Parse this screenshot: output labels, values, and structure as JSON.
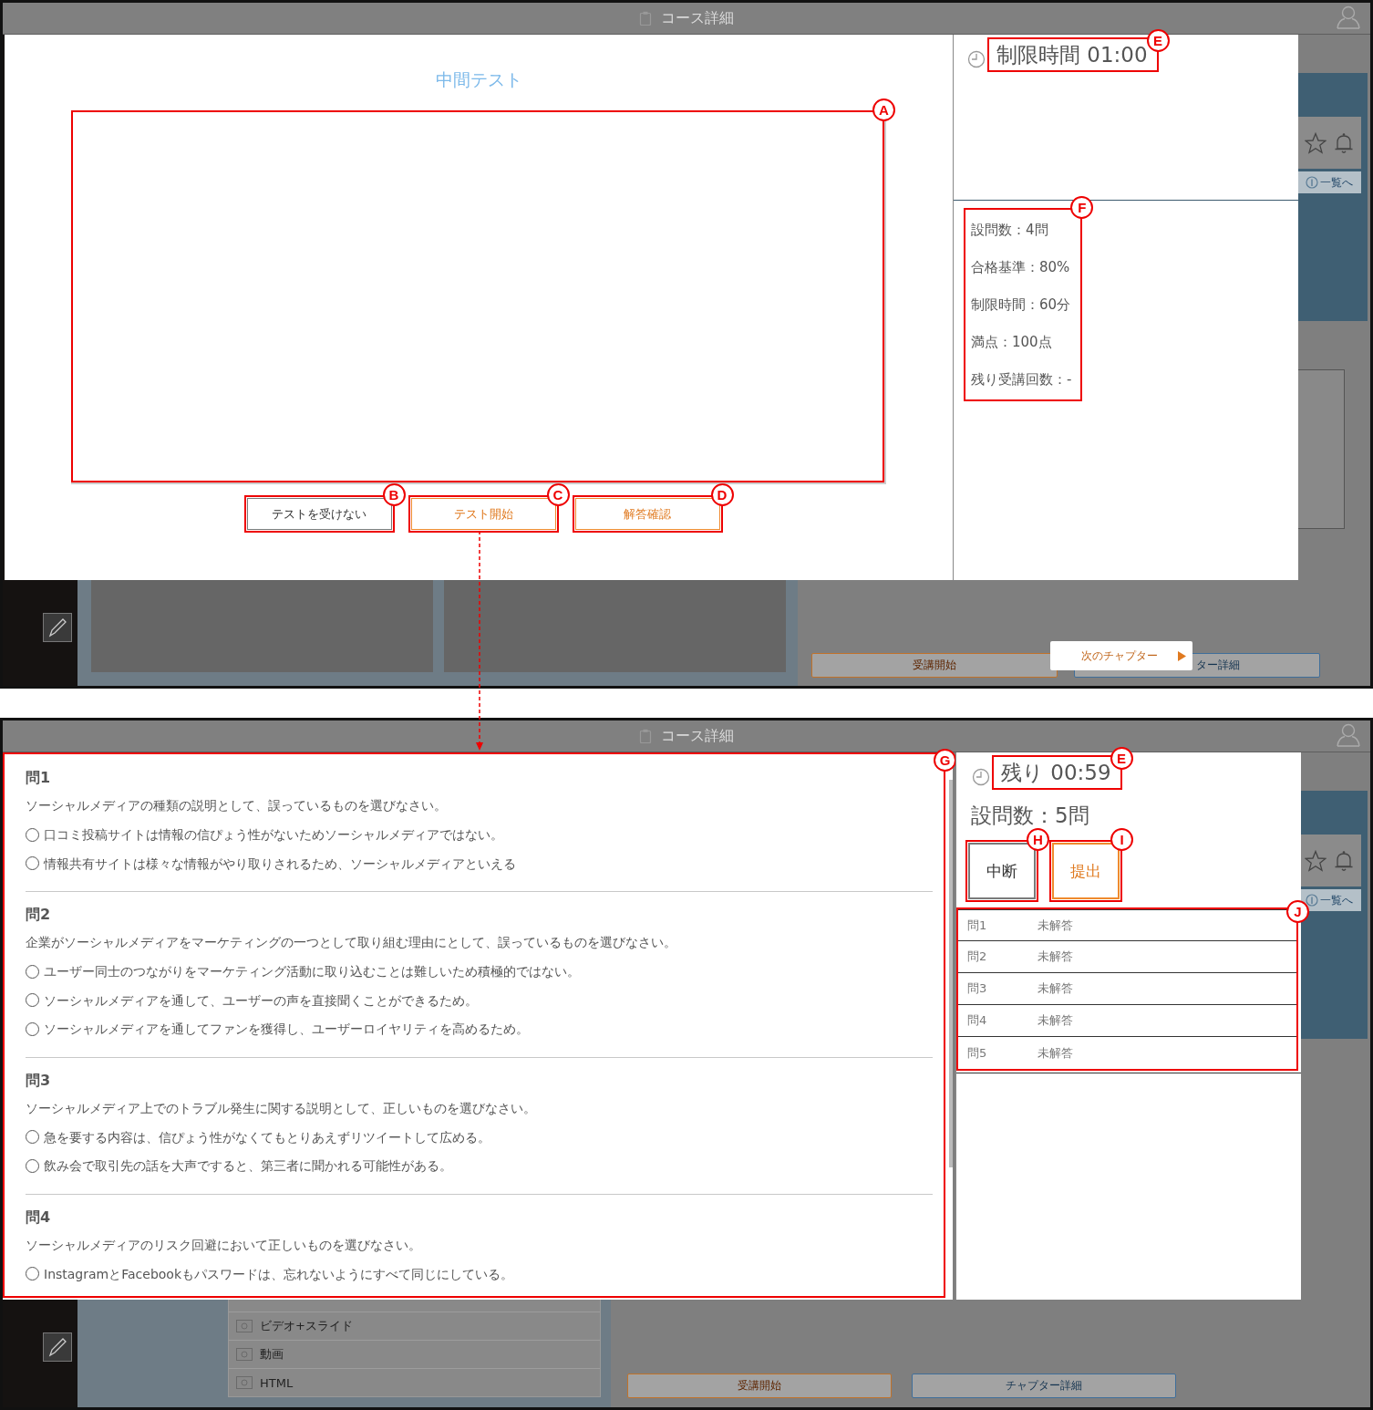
{
  "screen_1": {
    "window_title": "コース詳細",
    "background": {
      "list_link": "一覧へ",
      "buttons": [
        "受講開始",
        "ター詳細"
      ],
      "popup": "次のチャプター"
    },
    "test_title": "中間テスト",
    "content_callout": "A",
    "buttons": [
      {
        "label": "テストを受けない",
        "kind": "plain",
        "callout": "B"
      },
      {
        "label": "テスト開始",
        "kind": "accent",
        "callout": "C"
      },
      {
        "label": "解答確認",
        "kind": "accent",
        "callout": "D"
      }
    ],
    "timer": {
      "text": "制限時間 01:00",
      "callout": "E"
    },
    "info": {
      "callout": "F",
      "items": [
        "設問数：4問",
        "合格基準：80%",
        "制限時間：60分",
        "満点：100点",
        "残り受講回数：-"
      ]
    }
  },
  "screen_2": {
    "window_title": "コース詳細",
    "background": {
      "list_link": "一覧へ",
      "sidebar_items": [
        "ビデオ+スライド",
        "動画",
        "HTML"
      ],
      "buttons": [
        "受講開始",
        "チャプター詳細"
      ]
    },
    "questions_callout": "G",
    "questions": [
      {
        "title": "問1",
        "prompt": "ソーシャルメディアの種類の説明として、誤っているものを選びなさい。",
        "options": [
          {
            "text": "口コミ投稿サイトは情報の信ぴょう性がないためソーシャルメディアではない。",
            "selected": false
          },
          {
            "text": "情報共有サイトは様々な情報がやり取りされるため、ソーシャルメディアといえる",
            "selected": false
          }
        ]
      },
      {
        "title": "問2",
        "prompt": "企業がソーシャルメディアをマーケティングの一つとして取り組む理由にとして、誤っているものを選びなさい。",
        "options": [
          {
            "text": "ユーザー同士のつながりをマーケティング活動に取り込むことは難しいため積極的ではない。",
            "selected": false
          },
          {
            "text": "ソーシャルメディアを通して、ユーザーの声を直接聞くことができるため。",
            "selected": false
          },
          {
            "text": "ソーシャルメディアを通してファンを獲得し、ユーザーロイヤリティを高めるため。",
            "selected": false
          }
        ]
      },
      {
        "title": "問3",
        "prompt": "ソーシャルメディア上でのトラブル発生に関する説明として、正しいものを選びなさい。",
        "options": [
          {
            "text": "急を要する内容は、信ぴょう性がなくてもとりあえずリツイートして広める。",
            "selected": false
          },
          {
            "text": "飲み会で取引先の話を大声ですると、第三者に聞かれる可能性がある。",
            "selected": false
          }
        ]
      },
      {
        "title": "問4",
        "prompt": "ソーシャルメディアのリスク回避において正しいものを選びなさい。",
        "options": [
          {
            "text": "InstagramとFacebookもパスワードは、忘れないようにすべて同じにしている。",
            "selected": false
          }
        ]
      }
    ],
    "timer": {
      "text": "残り 00:59",
      "callout": "E"
    },
    "count": "設問数：5問",
    "buttons": [
      {
        "label": "中断",
        "kind": "plain",
        "callout": "H"
      },
      {
        "label": "提出",
        "kind": "accent",
        "callout": "I"
      }
    ],
    "status_callout": "J",
    "status": [
      {
        "question": "問1",
        "state": "未解答"
      },
      {
        "question": "問2",
        "state": "未解答"
      },
      {
        "question": "問3",
        "state": "未解答"
      },
      {
        "question": "問4",
        "state": "未解答"
      },
      {
        "question": "問5",
        "state": "未解答"
      }
    ]
  }
}
